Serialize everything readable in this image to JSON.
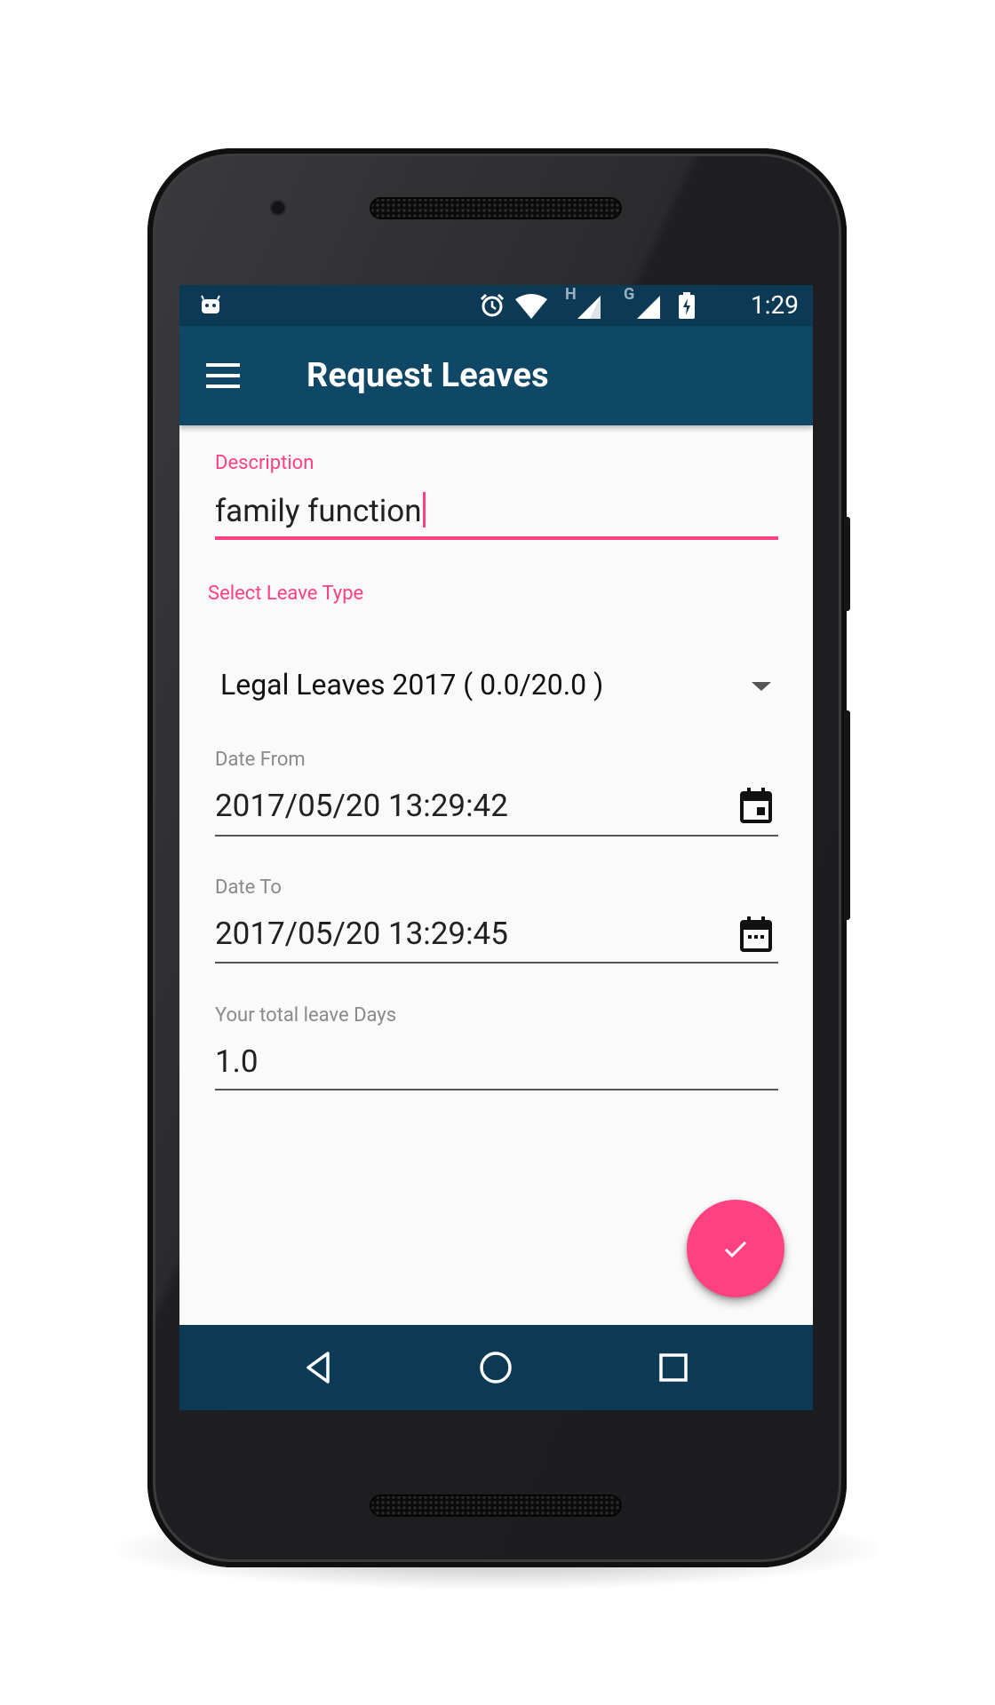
{
  "statusbar": {
    "time": "1:29",
    "icons": [
      "android-debug-icon",
      "alarm-icon",
      "wifi-icon",
      "signal-h-icon",
      "signal-g-icon",
      "battery-charging-icon"
    ],
    "network_labels": {
      "h": "H",
      "g": "G"
    }
  },
  "appbar": {
    "title": "Request Leaves",
    "menu_icon": "hamburger-menu-icon"
  },
  "form": {
    "description": {
      "label": "Description",
      "value": "family function"
    },
    "leave_type": {
      "label": "Select Leave Type",
      "value": "Legal Leaves 2017 ( 0.0/20.0 )"
    },
    "date_from": {
      "label": "Date From",
      "value": "2017/05/20 13:29:42"
    },
    "date_to": {
      "label": "Date To",
      "value": "2017/05/20 13:29:45"
    },
    "total_days": {
      "label": "Your total leave Days",
      "value": "1.0"
    }
  },
  "fab": {
    "icon": "check-icon"
  },
  "navbar": {
    "icons": [
      "back-icon",
      "home-icon",
      "recents-icon"
    ]
  },
  "colors": {
    "primary": "#0f4766",
    "primary_dark": "#0c3a55",
    "accent": "#ff4081",
    "background": "#fafafa"
  }
}
